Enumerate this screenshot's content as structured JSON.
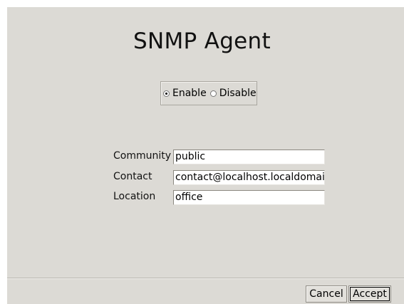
{
  "page": {
    "title": "SNMP Agent"
  },
  "agent_state": {
    "options": [
      {
        "label": "Enable",
        "selected": true
      },
      {
        "label": "Disable",
        "selected": false
      }
    ]
  },
  "form": {
    "community": {
      "label": "Community",
      "value": "public"
    },
    "contact": {
      "label": "Contact",
      "value": "contact@localhost.localdomain"
    },
    "location": {
      "label": "Location",
      "value": "office"
    }
  },
  "buttons": {
    "cancel": "Cancel",
    "accept": "Accept"
  }
}
